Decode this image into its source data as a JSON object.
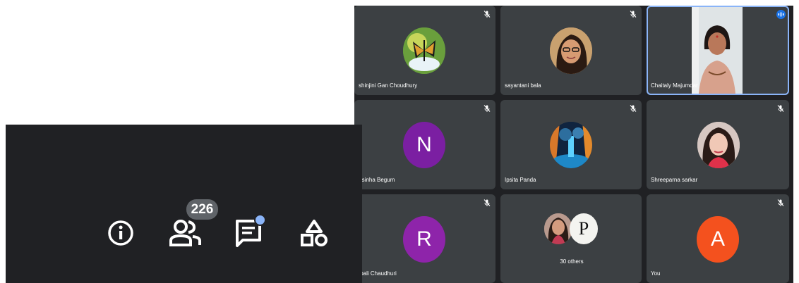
{
  "colors": {
    "tile_bg": "#3c4043",
    "grid_bg": "#202124",
    "active_outline": "#8ab4f8",
    "avatar_N": "#7b1fa2",
    "avatar_R": "#8e24aa",
    "avatar_A": "#f4511e",
    "chat_dot": "#8ab4f8"
  },
  "tiles": [
    {
      "name": "shinjini Gan Choudhury",
      "avatar_icon": "butterfly-photo-icon"
    },
    {
      "name": "sayantani bala",
      "avatar_icon": "profile-photo-icon"
    },
    {
      "name": "Chaitaly Majumdar",
      "avatar_icon": "video-feed-icon"
    },
    {
      "name": "Nousinha Begum",
      "avatar_letter": "N"
    },
    {
      "name": "Ipsita Panda",
      "avatar_icon": "forest-photo-icon"
    },
    {
      "name": "Shreeparna sarkar",
      "avatar_icon": "profile-photo-icon"
    },
    {
      "name": "Rupali Chaudhuri",
      "avatar_letter": "R"
    },
    {
      "name": "30 others",
      "avatar_letter_2": "P"
    },
    {
      "name": "You",
      "avatar_letter": "A"
    }
  ],
  "controls": {
    "participant_count": "226",
    "icons": [
      "info-icon",
      "people-icon",
      "chat-icon",
      "activities-icon"
    ]
  }
}
